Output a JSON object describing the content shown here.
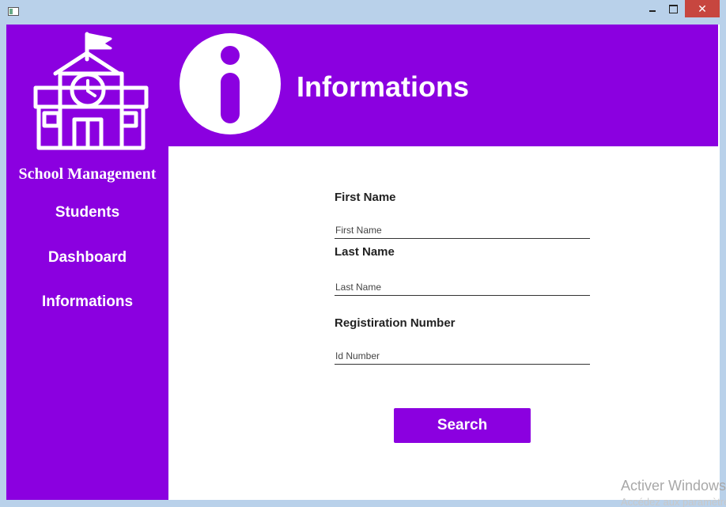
{
  "window": {
    "close_glyph": "✕"
  },
  "sidebar": {
    "logo_icon": "school-building-icon",
    "title": "School Management",
    "items": [
      {
        "label": "Students"
      },
      {
        "label": "Dashboard"
      },
      {
        "label": "Informations"
      }
    ]
  },
  "header": {
    "icon": "info-icon",
    "title": "Informations"
  },
  "form": {
    "first_name": {
      "label": "First Name",
      "placeholder": "First Name",
      "value": ""
    },
    "last_name": {
      "label": "Last Name",
      "placeholder": "Last Name",
      "value": ""
    },
    "registration": {
      "label": "Registiration Number",
      "placeholder": "Id Number",
      "value": ""
    },
    "search_label": "Search"
  },
  "watermark": {
    "line1": "Activer Windows",
    "line2": "Accédez aux paramètres"
  },
  "colors": {
    "accent": "#8b00e0",
    "titlebar": "#b9d1ea",
    "close": "#c7463f"
  }
}
